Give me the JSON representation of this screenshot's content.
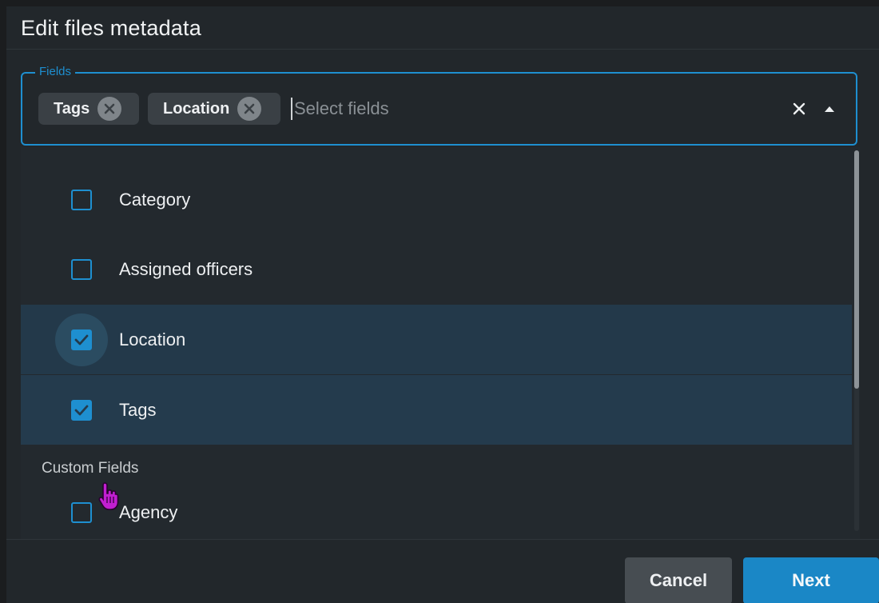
{
  "dialog": {
    "title": "Edit files metadata"
  },
  "fields_select": {
    "legend": "Fields",
    "placeholder": "Select fields",
    "value": "",
    "chips": [
      {
        "label": "Tags"
      },
      {
        "label": "Location"
      }
    ],
    "icons": {
      "chip_remove": "close-circle-icon",
      "clear": "close-icon",
      "toggle": "caret-up-icon"
    },
    "accent_color": "#1e8fd0"
  },
  "dropdown": {
    "options": [
      {
        "label": "Category",
        "checked": false
      },
      {
        "label": "Assigned officers",
        "checked": false
      },
      {
        "label": "Location",
        "checked": true
      },
      {
        "label": "Tags",
        "checked": true
      }
    ],
    "custom_group_label": "Custom Fields",
    "custom_options": [
      {
        "label": "Agency",
        "checked": false
      }
    ]
  },
  "footer": {
    "cancel_label": "Cancel",
    "next_label": "Next"
  }
}
